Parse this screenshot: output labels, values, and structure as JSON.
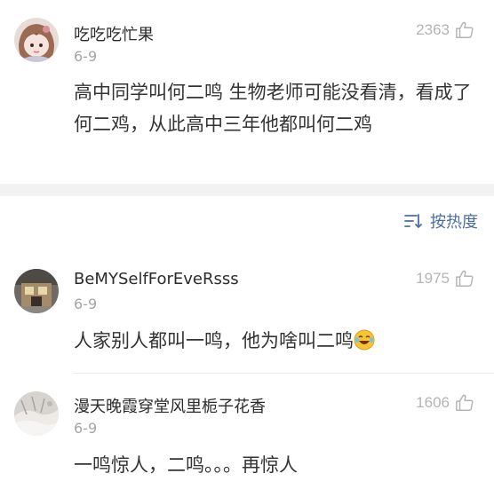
{
  "comments": [
    {
      "username": "吃吃吃忙果",
      "date": "6-9",
      "likes": "2363",
      "text": "高中同学叫何二鸣 生物老师可能没看清，看成了何二鸡，从此高中三年他都叫何二鸡",
      "avatar": "anime-girl-avatar"
    },
    {
      "username": "BeMYSelfForEveRsss",
      "date": "6-9",
      "likes": "1975",
      "text": "人家别人都叫一鸣，他为啥叫二鸣",
      "emoji": "laugh-cry-emoji",
      "avatar": "building-photo-avatar"
    },
    {
      "username": "漫天晚霞穿堂风里栀子花香",
      "date": "6-9",
      "likes": "1606",
      "text": "一鸣惊人，二鸣。。。再惊人",
      "avatar": "snow-photo-avatar"
    }
  ],
  "sort": {
    "label": "按热度",
    "icon": "sort-icon"
  },
  "colors": {
    "text": "#333333",
    "meta": "#a5a5a5",
    "like_count": "#b4b4b4",
    "accent": "#4a6ea3",
    "divider": "#f2f2f2"
  }
}
